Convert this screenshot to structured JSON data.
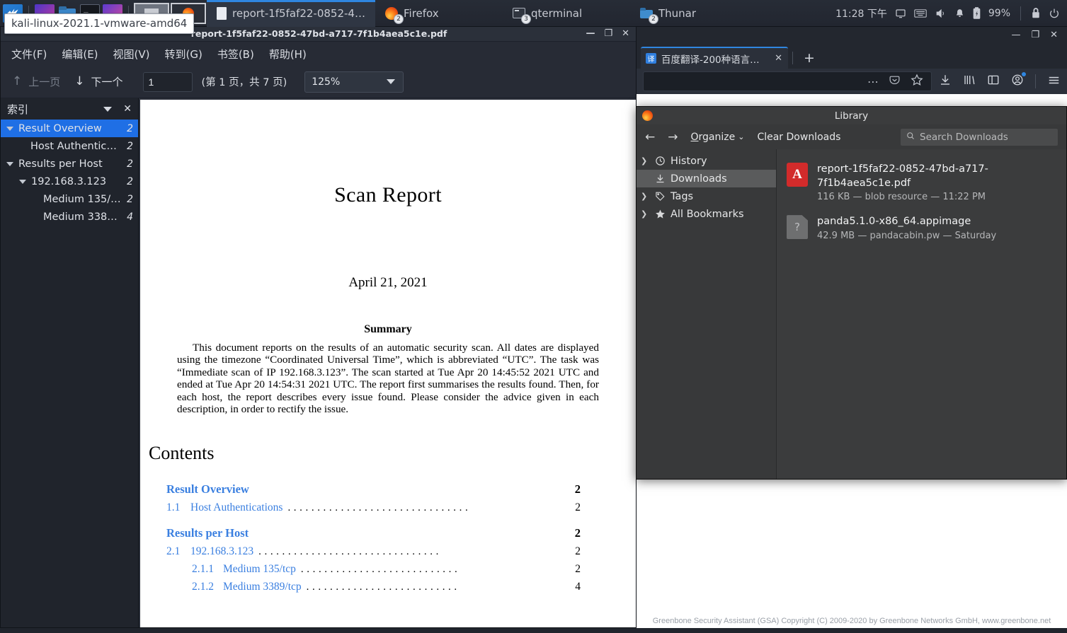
{
  "taskbar": {
    "launcher_icons": [
      "kali-menu-icon",
      "gimp-icon",
      "folder-icon",
      "terminal-icon",
      "app-icon"
    ],
    "window_buttons": [
      {
        "label": "report-1f5faf22-0852-4…",
        "badge": "",
        "icon": "document-icon",
        "active": true
      },
      {
        "label": "Firefox",
        "badge": "2",
        "icon": "firefox-icon",
        "active": false
      },
      {
        "label": "qterminal",
        "badge": "3",
        "icon": "terminal-icon",
        "active": false
      },
      {
        "label": "Thunar",
        "badge": "2",
        "icon": "file-manager-icon",
        "active": false
      }
    ],
    "clock": "11:28 下午",
    "tray_icons": [
      "display-icon",
      "keyboard-icon",
      "volume-icon",
      "notification-bell-icon",
      "battery-icon",
      "lock-icon",
      "power-icon"
    ],
    "battery": "99%"
  },
  "tooltip": {
    "text": "kali-linux-2021.1-vmware-amd64"
  },
  "pdf_viewer": {
    "title": "report-1f5faf22-0852-47bd-a717-7f1b4aea5c1e.pdf",
    "window_buttons": {
      "minimize": "—",
      "maximize": "❐",
      "close": "✕"
    },
    "menus": [
      "文件(F)",
      "编辑(E)",
      "视图(V)",
      "转到(G)",
      "书签(B)",
      "帮助(H)"
    ],
    "toolbar": {
      "prev_label": "上一页",
      "prev_icon": "arrow-up-icon",
      "next_label": "下一个",
      "next_icon": "arrow-down-icon",
      "page_value": "1",
      "page_placeholder": "",
      "page_of": "(第 1 页，共 7 页)",
      "zoom_value": "125%"
    },
    "index": {
      "header": "索引",
      "header_caret": "chevron-down-icon",
      "close": "✕",
      "items": [
        {
          "label": "Result Overview",
          "page": "2",
          "indent": 0,
          "expandable": true,
          "selected": true
        },
        {
          "label": "Host Authentica…",
          "page": "2",
          "indent": 1,
          "expandable": false,
          "selected": false
        },
        {
          "label": "Results per Host",
          "page": "2",
          "indent": 0,
          "expandable": true,
          "selected": false
        },
        {
          "label": "192.168.3.123",
          "page": "2",
          "indent": 1,
          "expandable": true,
          "selected": false
        },
        {
          "label": "Medium 135/tcp",
          "page": "2",
          "indent": 2,
          "expandable": false,
          "selected": false
        },
        {
          "label": "Medium 3389/t…",
          "page": "4",
          "indent": 2,
          "expandable": false,
          "selected": false
        }
      ]
    },
    "document": {
      "title": "Scan Report",
      "date": "April 21, 2021",
      "summary_heading": "Summary",
      "summary_text": "This document reports on the results of an automatic security scan. All dates are displayed using the timezone “Coordinated Universal Time”, which is abbreviated “UTC”. The task was “Immediate scan of IP 192.168.3.123”. The scan started at Tue Apr 20 14:45:52 2021 UTC and ended at Tue Apr 20 14:54:31 2021 UTC. The report first summarises the results found. Then, for each host, the report describes every issue found. Please consider the advice given in each description, in order to rectify the issue.",
      "contents_heading": "Contents",
      "toc": [
        {
          "kind": "chapter",
          "number": "",
          "title": "Result Overview",
          "page": "2"
        },
        {
          "kind": "section",
          "number": "1.1",
          "title": "Host Authentications",
          "page": "2"
        },
        {
          "kind": "chapter",
          "number": "",
          "title": "Results per Host",
          "page": "2"
        },
        {
          "kind": "section",
          "number": "2.1",
          "title": "192.168.3.123",
          "page": "2"
        },
        {
          "kind": "subsection",
          "number": "2.1.1",
          "title": "Medium 135/tcp",
          "page": "2"
        },
        {
          "kind": "subsection",
          "number": "2.1.2",
          "title": "Medium 3389/tcp",
          "page": "4"
        }
      ]
    }
  },
  "firefox": {
    "window_buttons": {
      "minimize": "—",
      "maximize": "❐",
      "close": "✕"
    },
    "tab": {
      "favicon": "译",
      "title": "百度翻译-200种语言互译",
      "close": "✕"
    },
    "new_tab": "+",
    "urlbar": {
      "value": "",
      "placeholder": ""
    },
    "urlbar_icons": [
      "page-actions-icon",
      "pocket-icon",
      "bookmark-star-icon"
    ],
    "nav_icons": [
      "downloads-icon",
      "library-icon",
      "sidebar-icon",
      "account-icon",
      "menu-icon"
    ],
    "footer": "Greenbone Security Assistant (GSA) Copyright (C) 2009-2020 by Greenbone Networks GmbH, www.greenbone.net"
  },
  "library": {
    "title": "Library",
    "toolbar": {
      "back_icon": "arrow-left-icon",
      "forward_icon": "arrow-right-icon",
      "organize": "Organize",
      "organize_accel": "O",
      "organize_rest": "rganize",
      "organize_caret": "chevron-down-icon",
      "clear_downloads": "Clear Downloads",
      "search_placeholder": "Search Downloads",
      "search_value": ""
    },
    "sidebar": [
      {
        "label": "History",
        "icon": "clock-icon",
        "chevron": true,
        "selected": false
      },
      {
        "label": "Downloads",
        "icon": "download-icon",
        "chevron": false,
        "selected": true
      },
      {
        "label": "Tags",
        "icon": "tag-icon",
        "chevron": true,
        "selected": false
      },
      {
        "label": "All Bookmarks",
        "icon": "star-icon",
        "chevron": true,
        "selected": false
      }
    ],
    "downloads": [
      {
        "name": "report-1f5faf22-0852-47bd-a717-7f1b4aea5c1e.pdf",
        "meta": "116 KB — blob resource — 11:22 PM",
        "icon": "pdf-file-icon"
      },
      {
        "name": "panda5.1.0-x86_64.appimage",
        "meta": "42.9 MB — pandacabin.pw — Saturday",
        "icon": "unknown-file-icon"
      }
    ]
  },
  "colors": {
    "accent_blue": "#1f6fe5",
    "taskbar_bg": "#272c36",
    "pdf_link_blue": "#3a7fe0",
    "library_bg": "#38393a"
  }
}
